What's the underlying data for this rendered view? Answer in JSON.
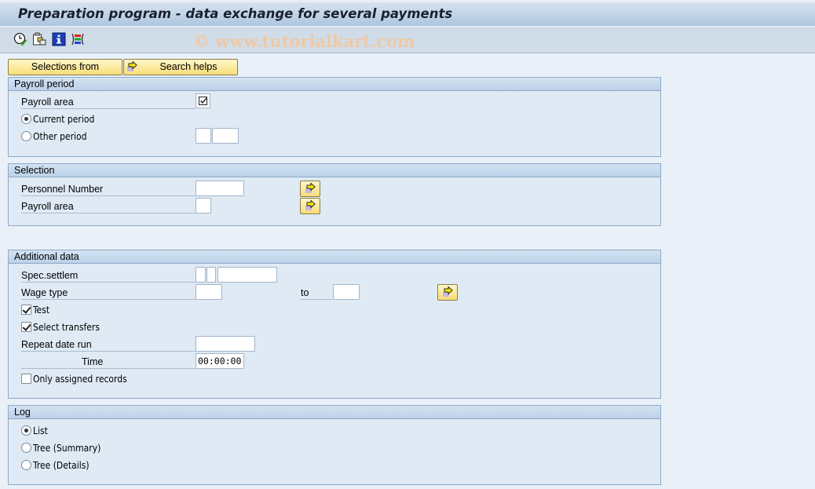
{
  "window": {
    "title": "Preparation program - data exchange for several payments",
    "watermark": "© www.tutorialkart.com"
  },
  "toolbar": {
    "icons": [
      "execute-clock-icon",
      "copy-variant-icon",
      "info-icon",
      "selection-options-icon"
    ]
  },
  "buttons": {
    "selections_from": "Selections from",
    "search_helps": "Search helps"
  },
  "payroll_period": {
    "title": "Payroll period",
    "payroll_area_label": "Payroll area",
    "payroll_area_checked": true,
    "current_period_label": "Current period",
    "current_period_selected": true,
    "other_period_label": "Other period",
    "other_period_selected": false,
    "other_period_value1": "",
    "other_period_value2": ""
  },
  "selection": {
    "title": "Selection",
    "personnel_number_label": "Personnel Number",
    "personnel_number_value": "",
    "payroll_area_label": "Payroll area",
    "payroll_area_value": ""
  },
  "additional": {
    "title": "Additional data",
    "spec_settlem_label": "Spec.settlem",
    "spec_settlem_values": [
      "",
      "",
      ""
    ],
    "wage_type_label": "Wage type",
    "wage_type_from": "",
    "to_label": "to",
    "wage_type_to": "",
    "test_label": "Test",
    "test_checked": true,
    "select_transfers_label": "Select transfers",
    "select_transfers_checked": true,
    "repeat_date_run_label": "Repeat date run",
    "repeat_date_run_value": "",
    "time_label": "Time",
    "time_value": "00:00:00",
    "only_assigned_label": "Only assigned records",
    "only_assigned_checked": false
  },
  "log": {
    "title": "Log",
    "options": [
      {
        "label": "List",
        "selected": true
      },
      {
        "label": "Tree (Summary)",
        "selected": false
      },
      {
        "label": "Tree (Details)",
        "selected": false
      }
    ]
  }
}
